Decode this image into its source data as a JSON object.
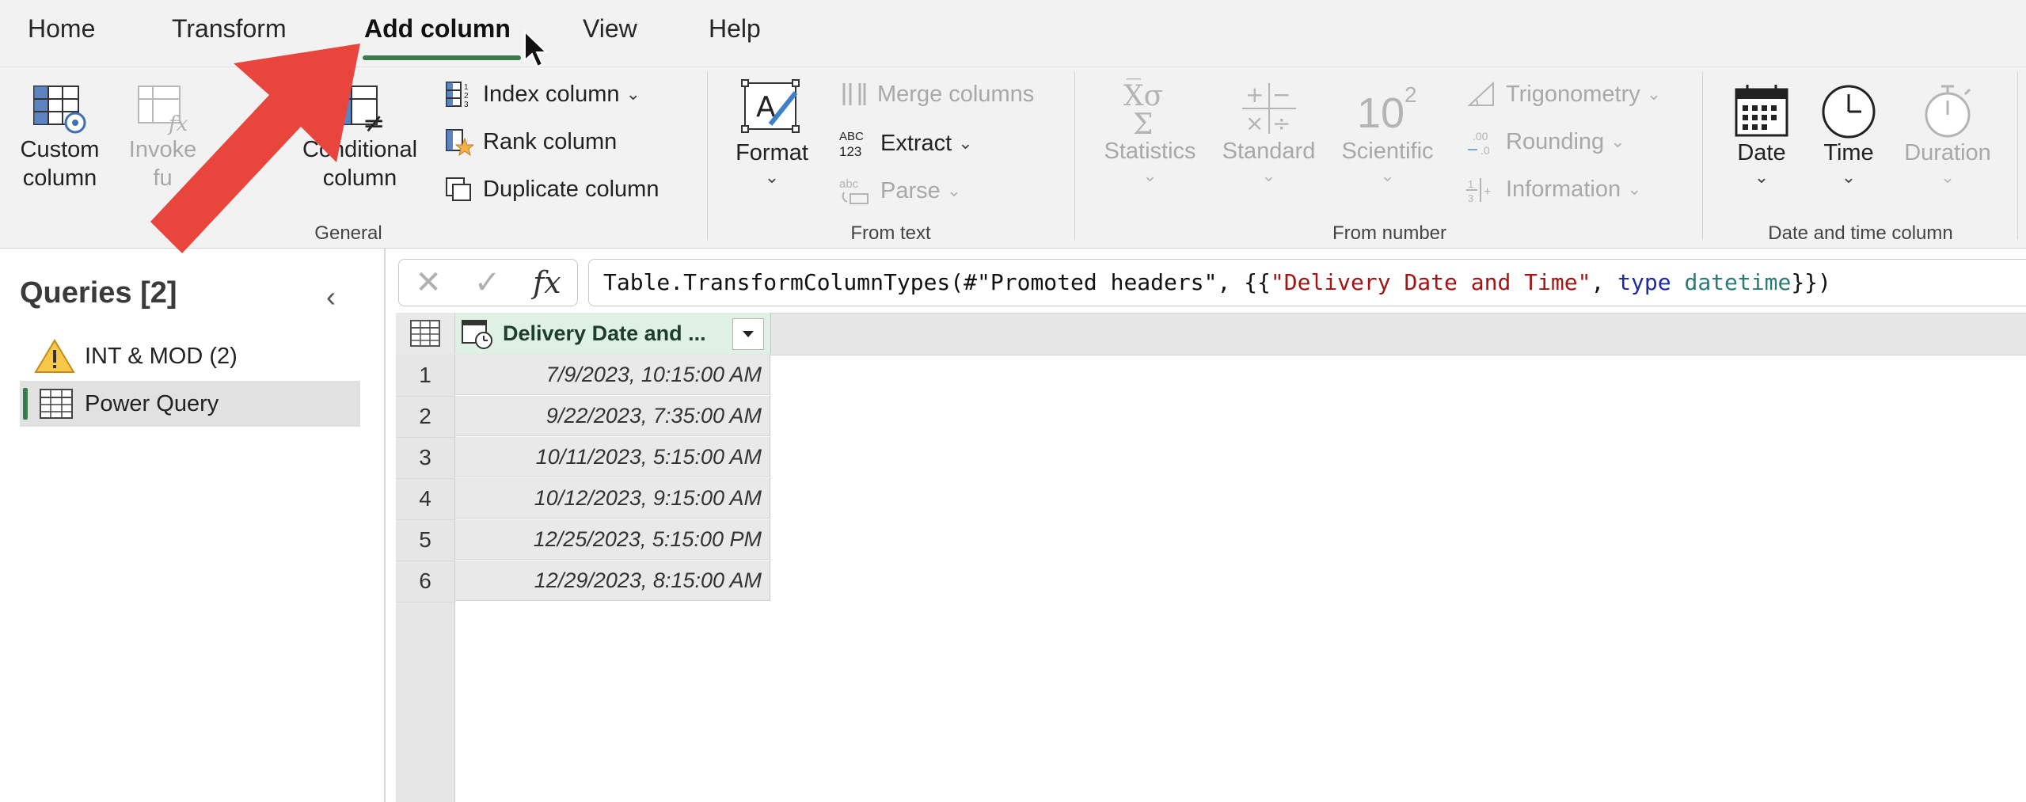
{
  "tabs": [
    {
      "label": "Home"
    },
    {
      "label": "Transform"
    },
    {
      "label": "Add column"
    },
    {
      "label": "View"
    },
    {
      "label": "Help"
    }
  ],
  "ribbon": {
    "general": {
      "group_label": "General",
      "custom_column": {
        "line1": "Custom",
        "line2": "column"
      },
      "invoke_function": {
        "line1": "Invoke",
        "line2": "fu"
      },
      "conditional_column": {
        "line1": "Conditional",
        "line2": "column"
      },
      "index_column": "Index column",
      "rank_column": "Rank column",
      "duplicate_column": "Duplicate column"
    },
    "from_text": {
      "group_label": "From text",
      "format": "Format",
      "merge_columns": "Merge columns",
      "extract": "Extract",
      "parse": "Parse"
    },
    "from_number": {
      "group_label": "From number",
      "statistics": "Statistics",
      "standard": "Standard",
      "scientific": "Scientific",
      "trigonometry": "Trigonometry",
      "rounding": "Rounding",
      "information": "Information"
    },
    "date_time": {
      "group_label": "Date and time column",
      "date": "Date",
      "time": "Time",
      "duration": "Duration"
    }
  },
  "queries": {
    "title": "Queries [2]",
    "items": [
      {
        "label": "INT & MOD (2)",
        "icon": "warning-icon"
      },
      {
        "label": "Power Query",
        "icon": "table-icon",
        "selected": true
      }
    ]
  },
  "formula": {
    "prefix": "Table.TransformColumnTypes(#\"Promoted headers\", {{",
    "string": "\"Delivery Date and Time\"",
    "sep": ", ",
    "keyword": "type",
    "space": " ",
    "type": "datetime",
    "suffix": "}})"
  },
  "table": {
    "column_header": "Delivery Date and ...",
    "rows": [
      {
        "num": "1",
        "value": "7/9/2023, 10:15:00 AM"
      },
      {
        "num": "2",
        "value": "9/22/2023, 7:35:00 AM"
      },
      {
        "num": "3",
        "value": "10/11/2023, 5:15:00 AM"
      },
      {
        "num": "4",
        "value": "10/12/2023, 9:15:00 AM"
      },
      {
        "num": "5",
        "value": "12/25/2023, 5:15:00 PM"
      },
      {
        "num": "6",
        "value": "12/29/2023, 8:15:00 AM"
      }
    ]
  },
  "colors": {
    "accent_green": "#3b7a4a",
    "arrow_red": "#e8453c"
  }
}
